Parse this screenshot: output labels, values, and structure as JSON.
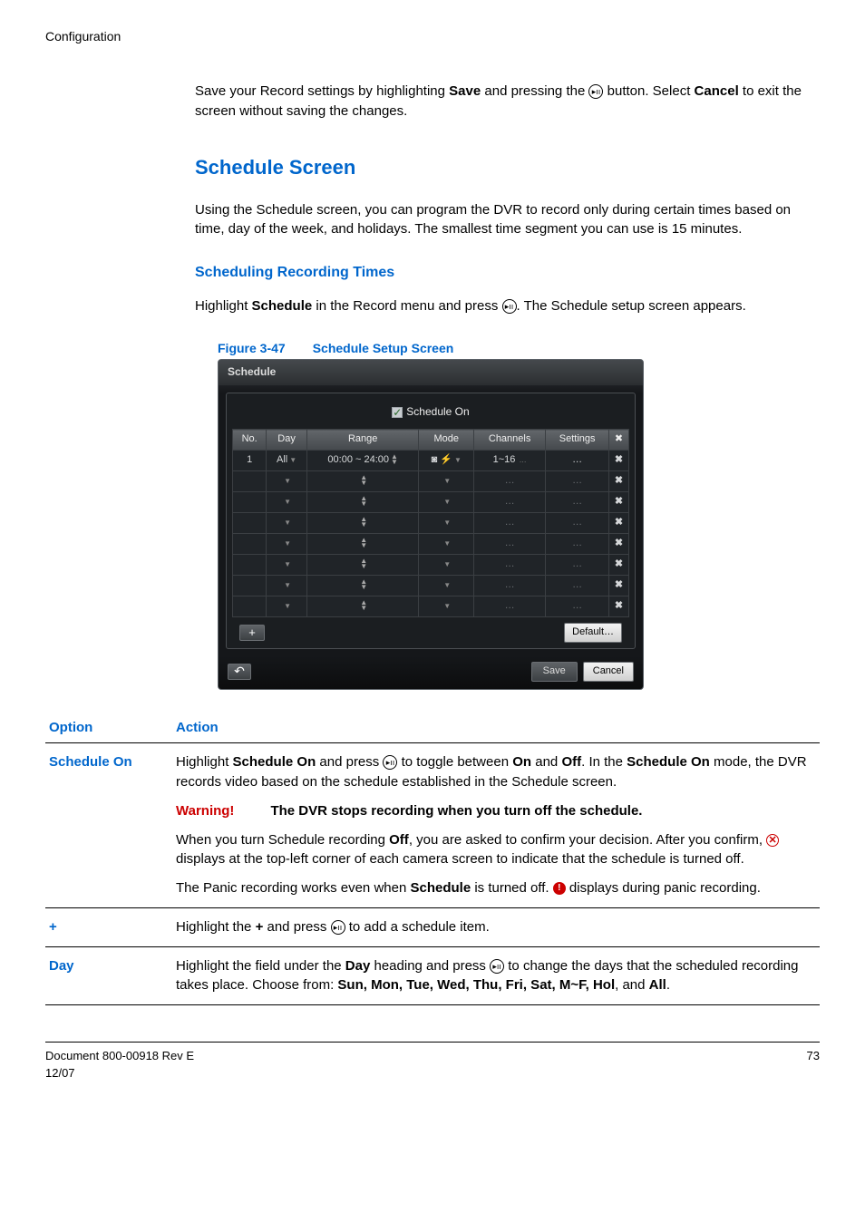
{
  "header": {
    "section": "Configuration"
  },
  "intro": {
    "text_before_save": "Save your Record settings by highlighting ",
    "save_word": "Save",
    "text_mid": " and pressing the ",
    "text_after_icon": " button. Select ",
    "cancel_word": "Cancel",
    "text_end": " to exit the screen without saving the changes."
  },
  "schedule_heading": "Schedule Screen",
  "schedule_intro": "Using the Schedule screen, you can program the DVR to record only during certain times based on time, day of the week, and holidays. The smallest time segment you can use is 15 minutes.",
  "sub_heading": "Scheduling Recording Times",
  "highlight_para": {
    "before": "Highlight ",
    "schedule_word": "Schedule",
    "mid": " in the Record menu and press ",
    "after": ". The Schedule setup screen appears."
  },
  "figure": {
    "label": "Figure 3-47",
    "title": "Schedule Setup Screen"
  },
  "shot": {
    "title": "Schedule",
    "schedule_on": "Schedule On",
    "cols": {
      "no": "No.",
      "day": "Day",
      "range": "Range",
      "mode": "Mode",
      "channels": "Channels",
      "settings": "Settings",
      "x": "✖"
    },
    "row1": {
      "no": "1",
      "day": "All",
      "range": "00:00 ~ 24:00",
      "mode": "◙ ⚡",
      "channels": "1~16",
      "settings": "…"
    },
    "plus": "+",
    "default": "Default…",
    "back": "↶",
    "save": "Save",
    "cancel": "Cancel"
  },
  "opts": {
    "head_option": "Option",
    "head_action": "Action",
    "schedule_on": {
      "label": "Schedule On",
      "p1a": "Highlight ",
      "p1b": "Schedule On",
      "p1c": " and press ",
      "p1d": " to toggle between ",
      "p1e": "On",
      "p1f": " and ",
      "p1g": "Off",
      "p1h": ". In the ",
      "p1i": "Schedule On",
      "p1j": " mode, the DVR records video based on the schedule established in the Schedule screen.",
      "warn_label": "Warning!",
      "warn_text": "The DVR stops recording when you turn off the schedule.",
      "p2a": "When you turn Schedule recording ",
      "p2b": "Off",
      "p2c": ", you are asked to confirm your decision. After you confirm, ",
      "p2d": " displays at the top-left corner of each camera screen to indicate that the schedule is turned off.",
      "p3a": "The Panic recording works even when ",
      "p3b": "Schedule",
      "p3c": " is turned off. ",
      "p3d": " displays during panic recording."
    },
    "plus": {
      "label": "+",
      "a": "Highlight the ",
      "b": "+",
      "c": " and press ",
      "d": " to add a schedule item."
    },
    "day": {
      "label": "Day",
      "a": "Highlight the field under the ",
      "b": "Day",
      "c": " heading and press ",
      "d": " to change the days that the scheduled recording takes place. Choose from: ",
      "list": "Sun, Mon, Tue, Wed, Thu, Fri, Sat, M~F, Hol",
      "e": ", and ",
      "all": "All",
      "f": "."
    }
  },
  "footer": {
    "doc": "Document 800-00918 Rev E",
    "date": "12/07",
    "page": "73"
  }
}
